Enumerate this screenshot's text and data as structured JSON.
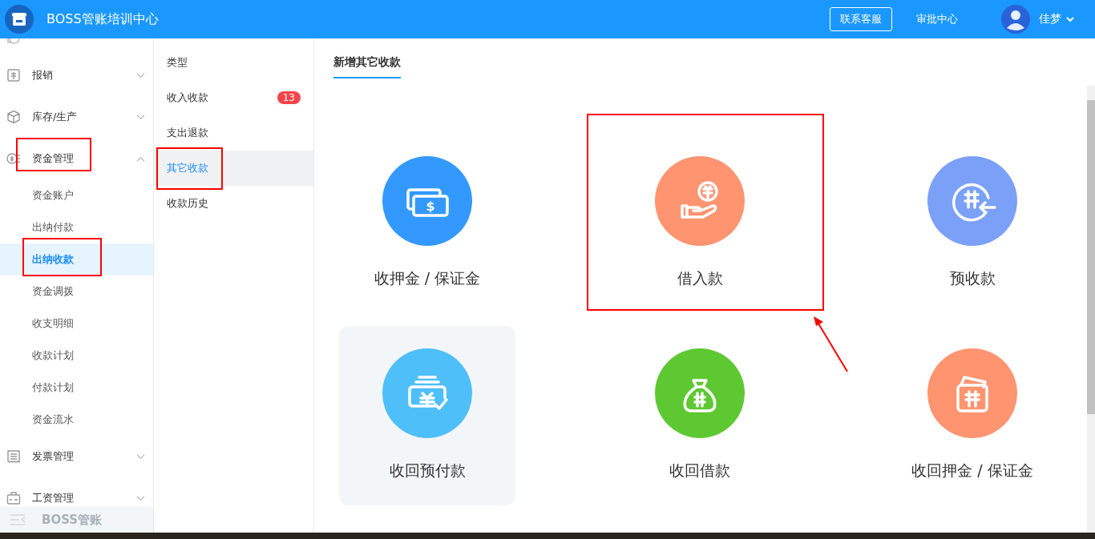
{
  "header": {
    "title": "BOSS管账培训中心",
    "support_button": "联系客服",
    "approval_link": "审批中心",
    "user_name": "佳梦"
  },
  "sidebar": {
    "items": [
      {
        "kind": "receipt",
        "label": "报销",
        "expanded": false,
        "annotated": false
      },
      {
        "kind": "box",
        "label": "库存/生产",
        "expanded": false,
        "annotated": false
      },
      {
        "kind": "money",
        "label": "资金管理",
        "expanded": true,
        "annotated": true,
        "children": [
          {
            "label": "资金账户",
            "selected": false,
            "annotated": false
          },
          {
            "label": "出纳付款",
            "selected": false,
            "annotated": false
          },
          {
            "label": "出纳收款",
            "selected": true,
            "annotated": true
          },
          {
            "label": "资金调拨",
            "selected": false,
            "annotated": false
          },
          {
            "label": "收支明细",
            "selected": false,
            "annotated": false
          },
          {
            "label": "收款计划",
            "selected": false,
            "annotated": false
          },
          {
            "label": "付款计划",
            "selected": false,
            "annotated": false
          },
          {
            "label": "资金流水",
            "selected": false,
            "annotated": false
          }
        ]
      },
      {
        "kind": "invoice",
        "label": "发票管理",
        "expanded": false,
        "annotated": false
      },
      {
        "kind": "salary",
        "label": "工资管理",
        "expanded": false,
        "annotated": false
      }
    ],
    "footer": "BOSS管账"
  },
  "type_menu": {
    "heading": "类型",
    "items": [
      {
        "label": "收入收款",
        "badge": "13",
        "selected": false,
        "annotated": false
      },
      {
        "label": "支出退款",
        "selected": false,
        "annotated": false
      },
      {
        "label": "其它收款",
        "selected": true,
        "annotated": true
      },
      {
        "label": "收款历史",
        "selected": false,
        "annotated": false
      }
    ]
  },
  "main": {
    "tab": "新增其它收款",
    "cards": [
      {
        "kind": "cash",
        "icon_text": "$",
        "label": "收押金 / 保证金",
        "color": "#3399ff",
        "hovered": false,
        "annotated": false
      },
      {
        "kind": "hand-coin",
        "label": "借入款",
        "color": "#ff9470",
        "hovered": false,
        "annotated": true
      },
      {
        "kind": "yuan-return",
        "label": "预收款",
        "color": "#7aa0f8",
        "hovered": false,
        "annotated": false
      },
      {
        "kind": "wallet-check",
        "label": "收回预付款",
        "color": "#4fbff9",
        "hovered": true,
        "annotated": false
      },
      {
        "kind": "money-bag",
        "label": "收回借款",
        "color": "#5ec832",
        "hovered": false,
        "annotated": false
      },
      {
        "kind": "card-wallet",
        "label": "收回押金 / 保证金",
        "color": "#ff9470",
        "hovered": false,
        "annotated": false
      }
    ]
  }
}
